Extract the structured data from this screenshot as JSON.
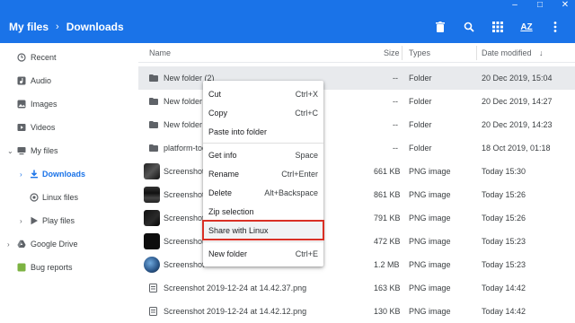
{
  "colors": {
    "accent": "#1a73e8",
    "highlight_box": "#d93025",
    "selected_row": "#e8eaed"
  },
  "window": {
    "controls": [
      "minimize-icon",
      "maximize-icon",
      "close-icon"
    ]
  },
  "toolbar": {
    "breadcrumb": [
      "My files",
      "Downloads"
    ],
    "separator": "›",
    "actions": [
      "delete-icon",
      "search-icon",
      "grid-view-icon",
      "sort-az-icon",
      "more-vert-icon"
    ],
    "sort_label": "AZ"
  },
  "sidebar": {
    "items": [
      {
        "label": "Recent",
        "icon": "clock-icon"
      },
      {
        "label": "Audio",
        "icon": "audio-icon"
      },
      {
        "label": "Images",
        "icon": "image-icon"
      },
      {
        "label": "Videos",
        "icon": "video-icon"
      },
      {
        "label": "My files",
        "icon": "computer-icon"
      },
      {
        "label": "Downloads",
        "icon": "download-icon"
      },
      {
        "label": "Linux files",
        "icon": "linux-icon"
      },
      {
        "label": "Play files",
        "icon": "play-icon"
      },
      {
        "label": "Google Drive",
        "icon": "drive-icon"
      },
      {
        "label": "Bug reports",
        "icon": "android-icon"
      }
    ]
  },
  "table": {
    "headers": {
      "name": "Name",
      "size": "Size",
      "type": "Types",
      "date": "Date modified",
      "sort_arrow": "↓"
    },
    "rows": [
      {
        "name": "New folder (2)",
        "size": "--",
        "type": "Folder",
        "date": "20 Dec 2019, 15:04"
      },
      {
        "name": "New folder",
        "size": "--",
        "type": "Folder",
        "date": "20 Dec 2019, 14:27"
      },
      {
        "name": "New folder (",
        "size": "--",
        "type": "Folder",
        "date": "20 Dec 2019, 14:23"
      },
      {
        "name": "platform-too",
        "size": "--",
        "type": "Folder",
        "date": "18 Oct 2019, 01:18"
      },
      {
        "name": "Screenshot",
        "size": "661 KB",
        "type": "PNG image",
        "date": "Today 15:30"
      },
      {
        "name": "Screenshot",
        "size": "861 KB",
        "type": "PNG image",
        "date": "Today 15:26"
      },
      {
        "name": "Screenshot",
        "size": "791 KB",
        "type": "PNG image",
        "date": "Today 15:26"
      },
      {
        "name": "Screenshot",
        "size": "472 KB",
        "type": "PNG image",
        "date": "Today 15:23"
      },
      {
        "name": "Screenshot",
        "size": "1.2 MB",
        "type": "PNG image",
        "date": "Today 15:23"
      },
      {
        "name": "Screenshot 2019-12-24 at 14.42.37.png",
        "size": "163 KB",
        "type": "PNG image",
        "date": "Today 14:42"
      },
      {
        "name": "Screenshot 2019-12-24 at 14.42.12.png",
        "size": "130 KB",
        "type": "PNG image",
        "date": "Today 14:42"
      }
    ]
  },
  "context_menu": {
    "items": [
      {
        "label": "Cut",
        "shortcut": "Ctrl+X"
      },
      {
        "label": "Copy",
        "shortcut": "Ctrl+C"
      },
      {
        "label": "Paste into folder",
        "shortcut": ""
      },
      {
        "label": "Get info",
        "shortcut": "Space"
      },
      {
        "label": "Rename",
        "shortcut": "Ctrl+Enter"
      },
      {
        "label": "Delete",
        "shortcut": "Alt+Backspace"
      },
      {
        "label": "Zip selection",
        "shortcut": ""
      },
      {
        "label": "Share with Linux",
        "shortcut": ""
      },
      {
        "label": "New folder",
        "shortcut": "Ctrl+E"
      }
    ]
  }
}
